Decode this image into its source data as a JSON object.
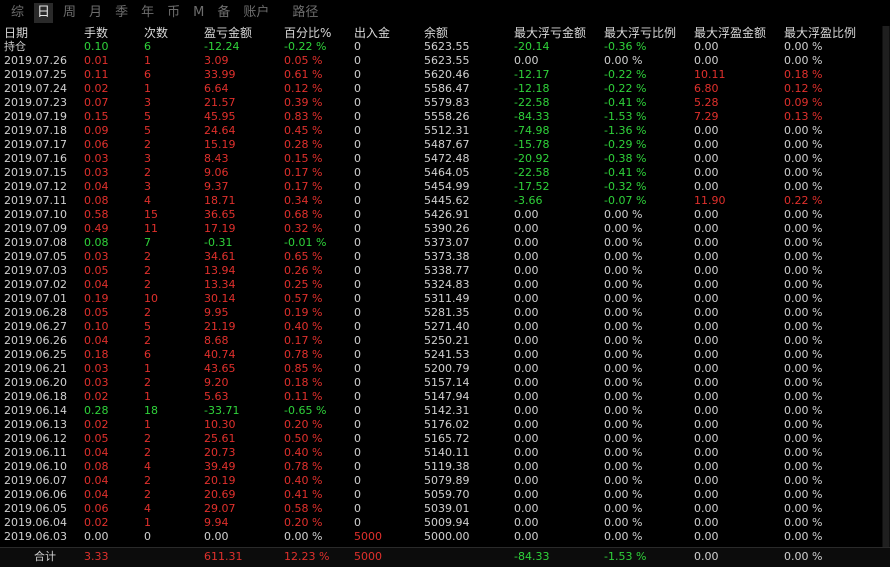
{
  "tabs": [
    {
      "label": "综",
      "active": false
    },
    {
      "label": "日",
      "active": true
    },
    {
      "label": "周",
      "active": false
    },
    {
      "label": "月",
      "active": false
    },
    {
      "label": "季",
      "active": false
    },
    {
      "label": "年",
      "active": false
    },
    {
      "label": "币",
      "active": false
    },
    {
      "label": "M",
      "active": false
    },
    {
      "label": "备",
      "active": false
    },
    {
      "label": "账户",
      "active": false
    },
    {
      "label": "路径",
      "active": false
    }
  ],
  "colors": {
    "red": "#e0302c",
    "green": "#2fd23a",
    "white": "#d0d0d0"
  },
  "columns": [
    "日期",
    "手数",
    "次数",
    "盈亏金额",
    "百分比%",
    "出入金",
    "余额",
    "最大浮亏金额",
    "最大浮亏比例",
    "最大浮盈金额",
    "最大浮盈比例"
  ],
  "rows": [
    {
      "cells": [
        "持仓",
        "0.10",
        "6",
        "-12.24",
        "-0.22 %",
        "0",
        "5623.55",
        "-20.14",
        "-0.36 %",
        "0.00",
        "0.00 %"
      ],
      "colors": [
        "w",
        "g",
        "g",
        "g",
        "g",
        "w",
        "w",
        "g",
        "g",
        "w",
        "w"
      ]
    },
    {
      "cells": [
        "2019.07.26",
        "0.01",
        "1",
        "3.09",
        "0.05 %",
        "0",
        "5623.55",
        "0.00",
        "0.00 %",
        "0.00",
        "0.00 %"
      ],
      "colors": [
        "w",
        "r",
        "r",
        "r",
        "r",
        "w",
        "w",
        "w",
        "w",
        "w",
        "w"
      ]
    },
    {
      "cells": [
        "2019.07.25",
        "0.11",
        "6",
        "33.99",
        "0.61 %",
        "0",
        "5620.46",
        "-12.17",
        "-0.22 %",
        "10.11",
        "0.18 %"
      ],
      "colors": [
        "w",
        "r",
        "r",
        "r",
        "r",
        "w",
        "w",
        "g",
        "g",
        "r",
        "r"
      ]
    },
    {
      "cells": [
        "2019.07.24",
        "0.02",
        "1",
        "6.64",
        "0.12 %",
        "0",
        "5586.47",
        "-12.18",
        "-0.22 %",
        "6.80",
        "0.12 %"
      ],
      "colors": [
        "w",
        "r",
        "r",
        "r",
        "r",
        "w",
        "w",
        "g",
        "g",
        "r",
        "r"
      ]
    },
    {
      "cells": [
        "2019.07.23",
        "0.07",
        "3",
        "21.57",
        "0.39 %",
        "0",
        "5579.83",
        "-22.58",
        "-0.41 %",
        "5.28",
        "0.09 %"
      ],
      "colors": [
        "w",
        "r",
        "r",
        "r",
        "r",
        "w",
        "w",
        "g",
        "g",
        "r",
        "r"
      ]
    },
    {
      "cells": [
        "2019.07.19",
        "0.15",
        "5",
        "45.95",
        "0.83 %",
        "0",
        "5558.26",
        "-84.33",
        "-1.53 %",
        "7.29",
        "0.13 %"
      ],
      "colors": [
        "w",
        "r",
        "r",
        "r",
        "r",
        "w",
        "w",
        "g",
        "g",
        "r",
        "r"
      ]
    },
    {
      "cells": [
        "2019.07.18",
        "0.09",
        "5",
        "24.64",
        "0.45 %",
        "0",
        "5512.31",
        "-74.98",
        "-1.36 %",
        "0.00",
        "0.00 %"
      ],
      "colors": [
        "w",
        "r",
        "r",
        "r",
        "r",
        "w",
        "w",
        "g",
        "g",
        "w",
        "w"
      ]
    },
    {
      "cells": [
        "2019.07.17",
        "0.06",
        "2",
        "15.19",
        "0.28 %",
        "0",
        "5487.67",
        "-15.78",
        "-0.29 %",
        "0.00",
        "0.00 %"
      ],
      "colors": [
        "w",
        "r",
        "r",
        "r",
        "r",
        "w",
        "w",
        "g",
        "g",
        "w",
        "w"
      ]
    },
    {
      "cells": [
        "2019.07.16",
        "0.03",
        "3",
        "8.43",
        "0.15 %",
        "0",
        "5472.48",
        "-20.92",
        "-0.38 %",
        "0.00",
        "0.00 %"
      ],
      "colors": [
        "w",
        "r",
        "r",
        "r",
        "r",
        "w",
        "w",
        "g",
        "g",
        "w",
        "w"
      ]
    },
    {
      "cells": [
        "2019.07.15",
        "0.03",
        "2",
        "9.06",
        "0.17 %",
        "0",
        "5464.05",
        "-22.58",
        "-0.41 %",
        "0.00",
        "0.00 %"
      ],
      "colors": [
        "w",
        "r",
        "r",
        "r",
        "r",
        "w",
        "w",
        "g",
        "g",
        "w",
        "w"
      ]
    },
    {
      "cells": [
        "2019.07.12",
        "0.04",
        "3",
        "9.37",
        "0.17 %",
        "0",
        "5454.99",
        "-17.52",
        "-0.32 %",
        "0.00",
        "0.00 %"
      ],
      "colors": [
        "w",
        "r",
        "r",
        "r",
        "r",
        "w",
        "w",
        "g",
        "g",
        "w",
        "w"
      ]
    },
    {
      "cells": [
        "2019.07.11",
        "0.08",
        "4",
        "18.71",
        "0.34 %",
        "0",
        "5445.62",
        "-3.66",
        "-0.07 %",
        "11.90",
        "0.22 %"
      ],
      "colors": [
        "w",
        "r",
        "r",
        "r",
        "r",
        "w",
        "w",
        "g",
        "g",
        "r",
        "r"
      ]
    },
    {
      "cells": [
        "2019.07.10",
        "0.58",
        "15",
        "36.65",
        "0.68 %",
        "0",
        "5426.91",
        "0.00",
        "0.00 %",
        "0.00",
        "0.00 %"
      ],
      "colors": [
        "w",
        "r",
        "r",
        "r",
        "r",
        "w",
        "w",
        "w",
        "w",
        "w",
        "w"
      ]
    },
    {
      "cells": [
        "2019.07.09",
        "0.49",
        "11",
        "17.19",
        "0.32 %",
        "0",
        "5390.26",
        "0.00",
        "0.00 %",
        "0.00",
        "0.00 %"
      ],
      "colors": [
        "w",
        "r",
        "r",
        "r",
        "r",
        "w",
        "w",
        "w",
        "w",
        "w",
        "w"
      ]
    },
    {
      "cells": [
        "2019.07.08",
        "0.08",
        "7",
        "-0.31",
        "-0.01 %",
        "0",
        "5373.07",
        "0.00",
        "0.00 %",
        "0.00",
        "0.00 %"
      ],
      "colors": [
        "w",
        "g",
        "g",
        "g",
        "g",
        "w",
        "w",
        "w",
        "w",
        "w",
        "w"
      ]
    },
    {
      "cells": [
        "2019.07.05",
        "0.03",
        "2",
        "34.61",
        "0.65 %",
        "0",
        "5373.38",
        "0.00",
        "0.00 %",
        "0.00",
        "0.00 %"
      ],
      "colors": [
        "w",
        "r",
        "r",
        "r",
        "r",
        "w",
        "w",
        "w",
        "w",
        "w",
        "w"
      ]
    },
    {
      "cells": [
        "2019.07.03",
        "0.05",
        "2",
        "13.94",
        "0.26 %",
        "0",
        "5338.77",
        "0.00",
        "0.00 %",
        "0.00",
        "0.00 %"
      ],
      "colors": [
        "w",
        "r",
        "r",
        "r",
        "r",
        "w",
        "w",
        "w",
        "w",
        "w",
        "w"
      ]
    },
    {
      "cells": [
        "2019.07.02",
        "0.04",
        "2",
        "13.34",
        "0.25 %",
        "0",
        "5324.83",
        "0.00",
        "0.00 %",
        "0.00",
        "0.00 %"
      ],
      "colors": [
        "w",
        "r",
        "r",
        "r",
        "r",
        "w",
        "w",
        "w",
        "w",
        "w",
        "w"
      ]
    },
    {
      "cells": [
        "2019.07.01",
        "0.19",
        "10",
        "30.14",
        "0.57 %",
        "0",
        "5311.49",
        "0.00",
        "0.00 %",
        "0.00",
        "0.00 %"
      ],
      "colors": [
        "w",
        "r",
        "r",
        "r",
        "r",
        "w",
        "w",
        "w",
        "w",
        "w",
        "w"
      ]
    },
    {
      "cells": [
        "2019.06.28",
        "0.05",
        "2",
        "9.95",
        "0.19 %",
        "0",
        "5281.35",
        "0.00",
        "0.00 %",
        "0.00",
        "0.00 %"
      ],
      "colors": [
        "w",
        "r",
        "r",
        "r",
        "r",
        "w",
        "w",
        "w",
        "w",
        "w",
        "w"
      ]
    },
    {
      "cells": [
        "2019.06.27",
        "0.10",
        "5",
        "21.19",
        "0.40 %",
        "0",
        "5271.40",
        "0.00",
        "0.00 %",
        "0.00",
        "0.00 %"
      ],
      "colors": [
        "w",
        "r",
        "r",
        "r",
        "r",
        "w",
        "w",
        "w",
        "w",
        "w",
        "w"
      ]
    },
    {
      "cells": [
        "2019.06.26",
        "0.04",
        "2",
        "8.68",
        "0.17 %",
        "0",
        "5250.21",
        "0.00",
        "0.00 %",
        "0.00",
        "0.00 %"
      ],
      "colors": [
        "w",
        "r",
        "r",
        "r",
        "r",
        "w",
        "w",
        "w",
        "w",
        "w",
        "w"
      ]
    },
    {
      "cells": [
        "2019.06.25",
        "0.18",
        "6",
        "40.74",
        "0.78 %",
        "0",
        "5241.53",
        "0.00",
        "0.00 %",
        "0.00",
        "0.00 %"
      ],
      "colors": [
        "w",
        "r",
        "r",
        "r",
        "r",
        "w",
        "w",
        "w",
        "w",
        "w",
        "w"
      ]
    },
    {
      "cells": [
        "2019.06.21",
        "0.03",
        "1",
        "43.65",
        "0.85 %",
        "0",
        "5200.79",
        "0.00",
        "0.00 %",
        "0.00",
        "0.00 %"
      ],
      "colors": [
        "w",
        "r",
        "r",
        "r",
        "r",
        "w",
        "w",
        "w",
        "w",
        "w",
        "w"
      ]
    },
    {
      "cells": [
        "2019.06.20",
        "0.03",
        "2",
        "9.20",
        "0.18 %",
        "0",
        "5157.14",
        "0.00",
        "0.00 %",
        "0.00",
        "0.00 %"
      ],
      "colors": [
        "w",
        "r",
        "r",
        "r",
        "r",
        "w",
        "w",
        "w",
        "w",
        "w",
        "w"
      ]
    },
    {
      "cells": [
        "2019.06.18",
        "0.02",
        "1",
        "5.63",
        "0.11 %",
        "0",
        "5147.94",
        "0.00",
        "0.00 %",
        "0.00",
        "0.00 %"
      ],
      "colors": [
        "w",
        "r",
        "r",
        "r",
        "r",
        "w",
        "w",
        "w",
        "w",
        "w",
        "w"
      ]
    },
    {
      "cells": [
        "2019.06.14",
        "0.28",
        "18",
        "-33.71",
        "-0.65 %",
        "0",
        "5142.31",
        "0.00",
        "0.00 %",
        "0.00",
        "0.00 %"
      ],
      "colors": [
        "w",
        "g",
        "g",
        "g",
        "g",
        "w",
        "w",
        "w",
        "w",
        "w",
        "w"
      ]
    },
    {
      "cells": [
        "2019.06.13",
        "0.02",
        "1",
        "10.30",
        "0.20 %",
        "0",
        "5176.02",
        "0.00",
        "0.00 %",
        "0.00",
        "0.00 %"
      ],
      "colors": [
        "w",
        "r",
        "r",
        "r",
        "r",
        "w",
        "w",
        "w",
        "w",
        "w",
        "w"
      ]
    },
    {
      "cells": [
        "2019.06.12",
        "0.05",
        "2",
        "25.61",
        "0.50 %",
        "0",
        "5165.72",
        "0.00",
        "0.00 %",
        "0.00",
        "0.00 %"
      ],
      "colors": [
        "w",
        "r",
        "r",
        "r",
        "r",
        "w",
        "w",
        "w",
        "w",
        "w",
        "w"
      ]
    },
    {
      "cells": [
        "2019.06.11",
        "0.04",
        "2",
        "20.73",
        "0.40 %",
        "0",
        "5140.11",
        "0.00",
        "0.00 %",
        "0.00",
        "0.00 %"
      ],
      "colors": [
        "w",
        "r",
        "r",
        "r",
        "r",
        "w",
        "w",
        "w",
        "w",
        "w",
        "w"
      ]
    },
    {
      "cells": [
        "2019.06.10",
        "0.08",
        "4",
        "39.49",
        "0.78 %",
        "0",
        "5119.38",
        "0.00",
        "0.00 %",
        "0.00",
        "0.00 %"
      ],
      "colors": [
        "w",
        "r",
        "r",
        "r",
        "r",
        "w",
        "w",
        "w",
        "w",
        "w",
        "w"
      ]
    },
    {
      "cells": [
        "2019.06.07",
        "0.04",
        "2",
        "20.19",
        "0.40 %",
        "0",
        "5079.89",
        "0.00",
        "0.00 %",
        "0.00",
        "0.00 %"
      ],
      "colors": [
        "w",
        "r",
        "r",
        "r",
        "r",
        "w",
        "w",
        "w",
        "w",
        "w",
        "w"
      ]
    },
    {
      "cells": [
        "2019.06.06",
        "0.04",
        "2",
        "20.69",
        "0.41 %",
        "0",
        "5059.70",
        "0.00",
        "0.00 %",
        "0.00",
        "0.00 %"
      ],
      "colors": [
        "w",
        "r",
        "r",
        "r",
        "r",
        "w",
        "w",
        "w",
        "w",
        "w",
        "w"
      ]
    },
    {
      "cells": [
        "2019.06.05",
        "0.06",
        "4",
        "29.07",
        "0.58 %",
        "0",
        "5039.01",
        "0.00",
        "0.00 %",
        "0.00",
        "0.00 %"
      ],
      "colors": [
        "w",
        "r",
        "r",
        "r",
        "r",
        "w",
        "w",
        "w",
        "w",
        "w",
        "w"
      ]
    },
    {
      "cells": [
        "2019.06.04",
        "0.02",
        "1",
        "9.94",
        "0.20 %",
        "0",
        "5009.94",
        "0.00",
        "0.00 %",
        "0.00",
        "0.00 %"
      ],
      "colors": [
        "w",
        "r",
        "r",
        "r",
        "r",
        "w",
        "w",
        "w",
        "w",
        "w",
        "w"
      ]
    },
    {
      "cells": [
        "2019.06.03",
        "0.00",
        "0",
        "0.00",
        "0.00 %",
        "5000",
        "5000.00",
        "0.00",
        "0.00 %",
        "0.00",
        "0.00 %"
      ],
      "colors": [
        "w",
        "w",
        "w",
        "w",
        "w",
        "r",
        "w",
        "w",
        "w",
        "w",
        "w"
      ]
    }
  ],
  "footer": {
    "cells": [
      "合计",
      "3.33",
      "",
      "611.31",
      "12.23 %",
      "5000",
      "",
      "-84.33",
      "-1.53 %",
      "0.00",
      "0.00 %"
    ],
    "colors": [
      "w",
      "r",
      "w",
      "r",
      "r",
      "r",
      "w",
      "g",
      "g",
      "w",
      "w"
    ]
  }
}
